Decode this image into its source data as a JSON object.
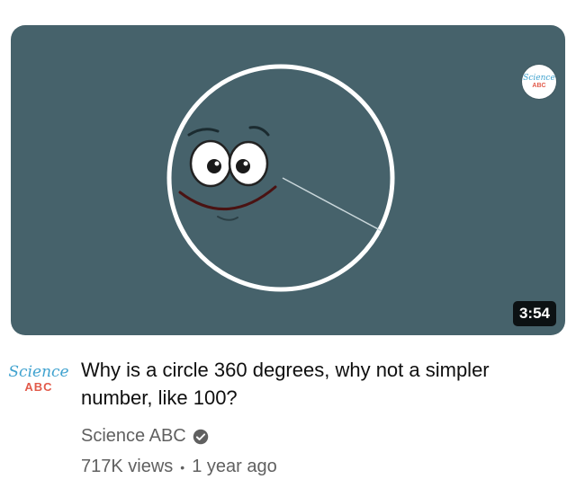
{
  "video": {
    "duration": "3:54",
    "thumbnail_bg": "#46626b",
    "watermark": {
      "line1": "Science",
      "line2": "ABC"
    }
  },
  "channel": {
    "logo_line1": "Science",
    "logo_line2": "ABC",
    "name": "Science ABC",
    "verified_icon": "verified-check-icon"
  },
  "details": {
    "title": "Why is a circle 360 degrees, why not a simpler number, like 100?",
    "views": "717K views",
    "separator": "•",
    "age": "1 year ago"
  }
}
